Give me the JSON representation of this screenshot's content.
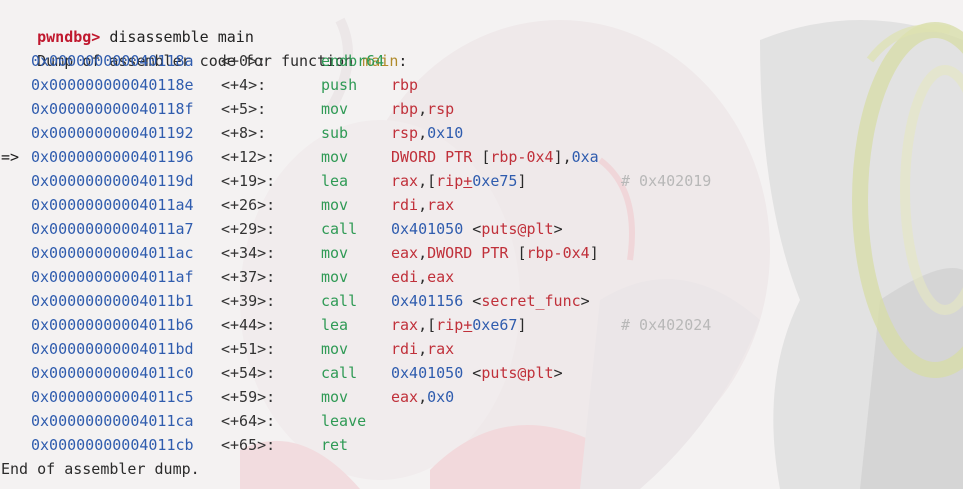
{
  "terminal": {
    "prompt": "pwndbg>",
    "command": " disassemble main",
    "dump_header_prefix": "Dump of assembler code for function ",
    "dump_header_fn": "main",
    "dump_header_suffix": ":",
    "current_arrow": "=>",
    "instructions": [
      {
        "addr": "0x000000000040118a",
        "off": "<+0>:",
        "mnem": "endbr64",
        "ops": []
      },
      {
        "addr": "0x000000000040118e",
        "off": "<+4>:",
        "mnem": "push",
        "ops": [
          {
            "t": "reg",
            "v": "rbp"
          }
        ]
      },
      {
        "addr": "0x000000000040118f",
        "off": "<+5>:",
        "mnem": "mov",
        "ops": [
          {
            "t": "reg",
            "v": "rbp"
          },
          {
            "t": "punct",
            "v": ","
          },
          {
            "t": "reg",
            "v": "rsp"
          }
        ]
      },
      {
        "addr": "0x0000000000401192",
        "off": "<+8>:",
        "mnem": "sub",
        "ops": [
          {
            "t": "reg",
            "v": "rsp"
          },
          {
            "t": "punct",
            "v": ","
          },
          {
            "t": "num",
            "v": "0x10"
          }
        ]
      },
      {
        "addr": "0x0000000000401196",
        "off": "<+12>:",
        "mnem": "mov",
        "current": true,
        "ops": [
          {
            "t": "reg",
            "v": "DWORD PTR "
          },
          {
            "t": "punct",
            "v": "["
          },
          {
            "t": "reg",
            "v": "rbp-0x4"
          },
          {
            "t": "punct",
            "v": "],"
          },
          {
            "t": "num",
            "v": "0xa"
          }
        ]
      },
      {
        "addr": "0x000000000040119d",
        "off": "<+19>:",
        "mnem": "lea",
        "ops": [
          {
            "t": "reg",
            "v": "rax"
          },
          {
            "t": "punct",
            "v": ",["
          },
          {
            "t": "reg",
            "v": "rip"
          },
          {
            "t": "plus",
            "v": "+"
          },
          {
            "t": "num",
            "v": "0xe75"
          },
          {
            "t": "punct",
            "v": "]"
          }
        ],
        "comment": "# 0x402019"
      },
      {
        "addr": "0x00000000004011a4",
        "off": "<+26>:",
        "mnem": "mov",
        "ops": [
          {
            "t": "reg",
            "v": "rdi"
          },
          {
            "t": "punct",
            "v": ","
          },
          {
            "t": "reg",
            "v": "rax"
          }
        ]
      },
      {
        "addr": "0x00000000004011a7",
        "off": "<+29>:",
        "mnem": "call",
        "ops": [
          {
            "t": "num",
            "v": "0x401050"
          },
          {
            "t": "punct",
            "v": " <"
          },
          {
            "t": "reg",
            "v": "puts@plt"
          },
          {
            "t": "punct",
            "v": ">"
          }
        ]
      },
      {
        "addr": "0x00000000004011ac",
        "off": "<+34>:",
        "mnem": "mov",
        "ops": [
          {
            "t": "reg",
            "v": "eax"
          },
          {
            "t": "punct",
            "v": ","
          },
          {
            "t": "reg",
            "v": "DWORD PTR "
          },
          {
            "t": "punct",
            "v": "["
          },
          {
            "t": "reg",
            "v": "rbp-0x4"
          },
          {
            "t": "punct",
            "v": "]"
          }
        ]
      },
      {
        "addr": "0x00000000004011af",
        "off": "<+37>:",
        "mnem": "mov",
        "ops": [
          {
            "t": "reg",
            "v": "edi"
          },
          {
            "t": "punct",
            "v": ","
          },
          {
            "t": "reg",
            "v": "eax"
          }
        ]
      },
      {
        "addr": "0x00000000004011b1",
        "off": "<+39>:",
        "mnem": "call",
        "ops": [
          {
            "t": "num",
            "v": "0x401156"
          },
          {
            "t": "punct",
            "v": " <"
          },
          {
            "t": "reg",
            "v": "secret_func"
          },
          {
            "t": "punct",
            "v": ">"
          }
        ]
      },
      {
        "addr": "0x00000000004011b6",
        "off": "<+44>:",
        "mnem": "lea",
        "ops": [
          {
            "t": "reg",
            "v": "rax"
          },
          {
            "t": "punct",
            "v": ",["
          },
          {
            "t": "reg",
            "v": "rip"
          },
          {
            "t": "plus",
            "v": "+"
          },
          {
            "t": "num",
            "v": "0xe67"
          },
          {
            "t": "punct",
            "v": "]"
          }
        ],
        "comment": "# 0x402024"
      },
      {
        "addr": "0x00000000004011bd",
        "off": "<+51>:",
        "mnem": "mov",
        "ops": [
          {
            "t": "reg",
            "v": "rdi"
          },
          {
            "t": "punct",
            "v": ","
          },
          {
            "t": "reg",
            "v": "rax"
          }
        ]
      },
      {
        "addr": "0x00000000004011c0",
        "off": "<+54>:",
        "mnem": "call",
        "ops": [
          {
            "t": "num",
            "v": "0x401050"
          },
          {
            "t": "punct",
            "v": " <"
          },
          {
            "t": "reg",
            "v": "puts@plt"
          },
          {
            "t": "punct",
            "v": ">"
          }
        ]
      },
      {
        "addr": "0x00000000004011c5",
        "off": "<+59>:",
        "mnem": "mov",
        "ops": [
          {
            "t": "reg",
            "v": "eax"
          },
          {
            "t": "punct",
            "v": ","
          },
          {
            "t": "num",
            "v": "0x0"
          }
        ]
      },
      {
        "addr": "0x00000000004011ca",
        "off": "<+64>:",
        "mnem": "leave",
        "ops": []
      },
      {
        "addr": "0x00000000004011cb",
        "off": "<+65>:",
        "mnem": "ret",
        "ops": []
      }
    ],
    "dump_footer": "End of assembler dump."
  },
  "colors": {
    "prompt": "#c0182e",
    "address": "#2f5cae",
    "mnemonic": "#2f9a55",
    "register": "#c0303a",
    "function_name": "#b08a2a",
    "comment": "#b8b8b8"
  }
}
